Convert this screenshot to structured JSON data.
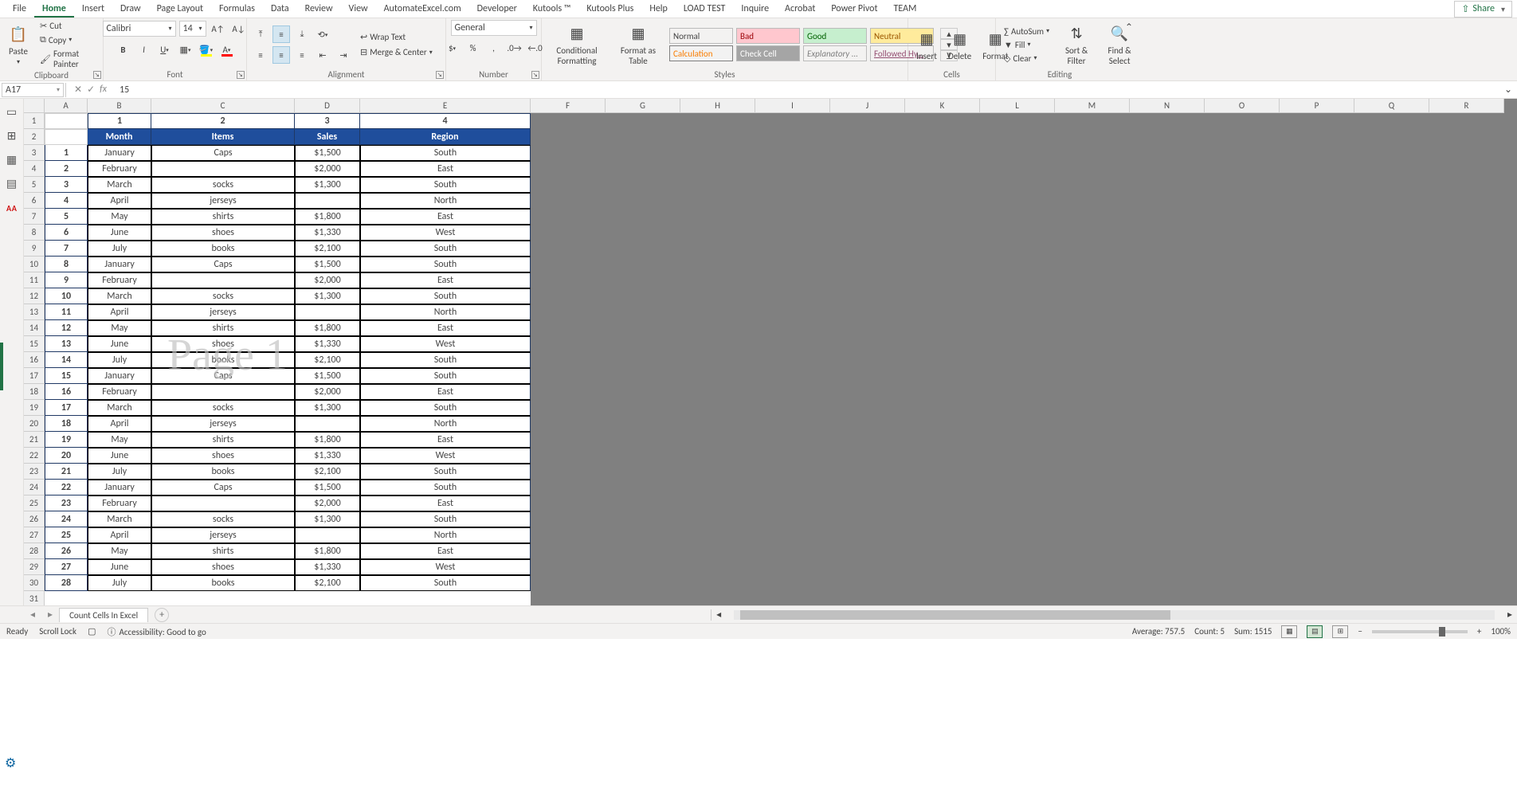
{
  "tabs": [
    "File",
    "Home",
    "Insert",
    "Draw",
    "Page Layout",
    "Formulas",
    "Data",
    "Review",
    "View",
    "AutomateExcel.com",
    "Developer",
    "Kutools ™",
    "Kutools Plus",
    "Help",
    "LOAD TEST",
    "Inquire",
    "Acrobat",
    "Power Pivot",
    "TEAM"
  ],
  "active_tab": "Home",
  "share": "Share",
  "clipboard": {
    "paste": "Paste",
    "cut": "Cut",
    "copy": "Copy",
    "painter": "Format Painter",
    "label": "Clipboard"
  },
  "font": {
    "name": "Calibri",
    "size": "14",
    "label": "Font"
  },
  "alignment": {
    "wrap": "Wrap Text",
    "merge": "Merge & Center",
    "label": "Alignment"
  },
  "number": {
    "format": "General",
    "label": "Number"
  },
  "cond": {
    "cf": "Conditional Formatting",
    "ft": "Format as Table"
  },
  "styles": {
    "normal": "Normal",
    "bad": "Bad",
    "good": "Good",
    "neutral": "Neutral",
    "calc": "Calculation",
    "check": "Check Cell",
    "expl": "Explanatory ...",
    "link": "Followed Hy...",
    "label": "Styles"
  },
  "cells": {
    "insert": "Insert",
    "delete": "Delete",
    "format": "Format",
    "label": "Cells"
  },
  "editing": {
    "sum": "AutoSum",
    "fill": "Fill",
    "clear": "Clear",
    "sort": "Sort & Filter",
    "find": "Find & Select",
    "label": "Editing"
  },
  "namebox": "A17",
  "formula": "15",
  "cols": [
    "A",
    "B",
    "C",
    "D",
    "E",
    "F",
    "G",
    "H",
    "I",
    "J",
    "K",
    "L",
    "M",
    "N",
    "O",
    "P",
    "Q",
    "R"
  ],
  "top_nums": [
    "1",
    "2",
    "3",
    "4"
  ],
  "headers": [
    "Month",
    "Items",
    "Sales",
    "Region"
  ],
  "rows": [
    {
      "n": "1",
      "m": "January",
      "i": "Caps",
      "s": "$1,500",
      "r": "South"
    },
    {
      "n": "2",
      "m": "February",
      "i": "",
      "s": "$2,000",
      "r": "East"
    },
    {
      "n": "3",
      "m": "March",
      "i": "socks",
      "s": "$1,300",
      "r": "South"
    },
    {
      "n": "4",
      "m": "April",
      "i": "jerseys",
      "s": "",
      "r": "North"
    },
    {
      "n": "5",
      "m": "May",
      "i": "shirts",
      "s": "$1,800",
      "r": "East"
    },
    {
      "n": "6",
      "m": "June",
      "i": "shoes",
      "s": "$1,330",
      "r": "West"
    },
    {
      "n": "7",
      "m": "July",
      "i": "books",
      "s": "$2,100",
      "r": "South"
    },
    {
      "n": "8",
      "m": "January",
      "i": "Caps",
      "s": "$1,500",
      "r": "South"
    },
    {
      "n": "9",
      "m": "February",
      "i": "",
      "s": "$2,000",
      "r": "East"
    },
    {
      "n": "10",
      "m": "March",
      "i": "socks",
      "s": "$1,300",
      "r": "South"
    },
    {
      "n": "11",
      "m": "April",
      "i": "jerseys",
      "s": "",
      "r": "North"
    },
    {
      "n": "12",
      "m": "May",
      "i": "shirts",
      "s": "$1,800",
      "r": "East"
    },
    {
      "n": "13",
      "m": "June",
      "i": "shoes",
      "s": "$1,330",
      "r": "West"
    },
    {
      "n": "14",
      "m": "July",
      "i": "books",
      "s": "$2,100",
      "r": "South"
    },
    {
      "n": "15",
      "m": "January",
      "i": "Caps",
      "s": "$1,500",
      "r": "South"
    },
    {
      "n": "16",
      "m": "February",
      "i": "",
      "s": "$2,000",
      "r": "East"
    },
    {
      "n": "17",
      "m": "March",
      "i": "socks",
      "s": "$1,300",
      "r": "South"
    },
    {
      "n": "18",
      "m": "April",
      "i": "jerseys",
      "s": "",
      "r": "North"
    },
    {
      "n": "19",
      "m": "May",
      "i": "shirts",
      "s": "$1,800",
      "r": "East"
    },
    {
      "n": "20",
      "m": "June",
      "i": "shoes",
      "s": "$1,330",
      "r": "West"
    },
    {
      "n": "21",
      "m": "July",
      "i": "books",
      "s": "$2,100",
      "r": "South"
    },
    {
      "n": "22",
      "m": "January",
      "i": "Caps",
      "s": "$1,500",
      "r": "South"
    },
    {
      "n": "23",
      "m": "February",
      "i": "",
      "s": "$2,000",
      "r": "East"
    },
    {
      "n": "24",
      "m": "March",
      "i": "socks",
      "s": "$1,300",
      "r": "South"
    },
    {
      "n": "25",
      "m": "April",
      "i": "jerseys",
      "s": "",
      "r": "North"
    },
    {
      "n": "26",
      "m": "May",
      "i": "shirts",
      "s": "$1,800",
      "r": "East"
    },
    {
      "n": "27",
      "m": "June",
      "i": "shoes",
      "s": "$1,330",
      "r": "West"
    },
    {
      "n": "28",
      "m": "July",
      "i": "books",
      "s": "$2,100",
      "r": "South"
    }
  ],
  "watermark": "Page 1",
  "sheet_tab": "Count Cells In Excel",
  "status": {
    "ready": "Ready",
    "scroll": "Scroll Lock",
    "acc": "Accessibility: Good to go",
    "avg": "Average: 757.5",
    "count": "Count: 5",
    "sum": "Sum: 1515",
    "zoom": "100%"
  }
}
